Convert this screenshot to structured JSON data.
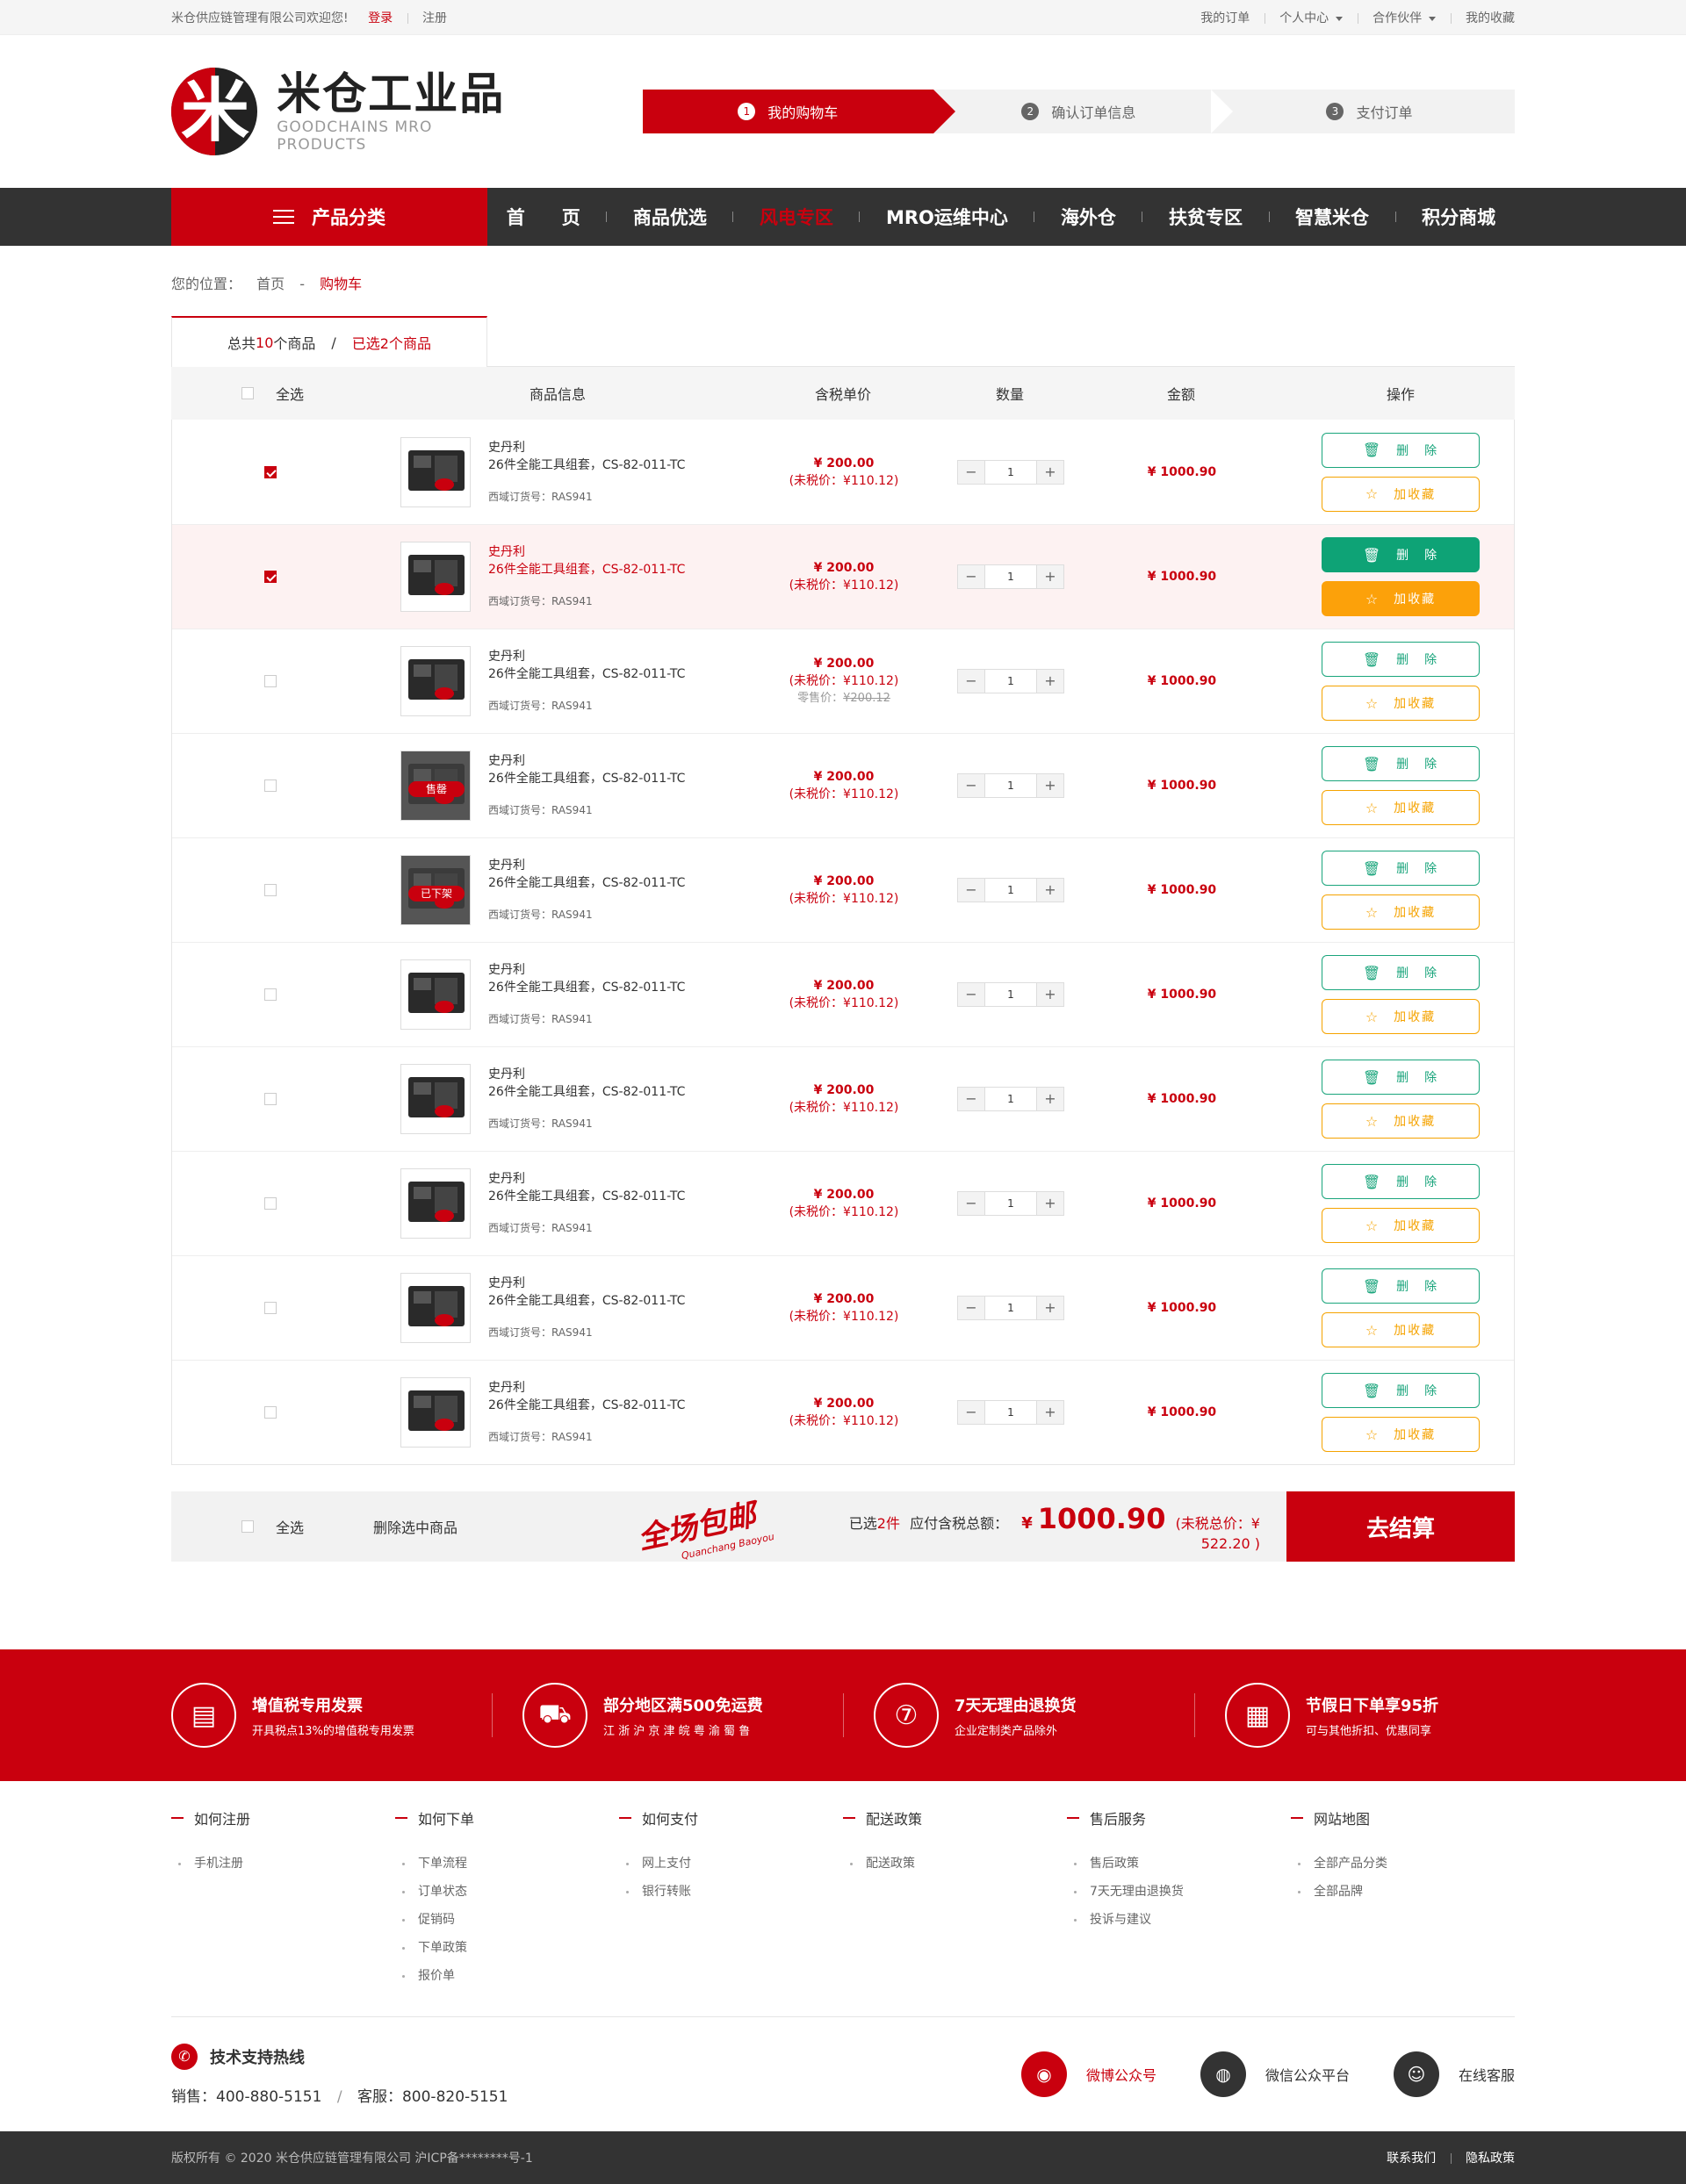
{
  "topbar": {
    "welcome": "米仓供应链管理有限公司欢迎您!",
    "login": "登录",
    "register": "注册",
    "my_orders": "我的订单",
    "personal_center": "个人中心",
    "partners": "合作伙伴",
    "my_favorites": "我的收藏"
  },
  "logo": {
    "cn": "米仓工业品",
    "en": "GOODCHAINS MRO PRODUCTS",
    "glyph": "米"
  },
  "steps": [
    {
      "num": "1",
      "label": "我的购物车"
    },
    {
      "num": "2",
      "label": "确认订单信息"
    },
    {
      "num": "3",
      "label": "支付订单"
    }
  ],
  "nav": {
    "category": "产品分类",
    "links": [
      "首　　页",
      "商品优选",
      "风电专区",
      "MRO运维中心",
      "海外仓",
      "扶贫专区",
      "智慧米仓",
      "积分商城"
    ]
  },
  "breadcrumb": {
    "label": "您的位置：",
    "home": "首页",
    "sep": "-",
    "current": "购物车"
  },
  "cart_tab": {
    "pre": "总共",
    "total": "10",
    "mid": "个商品",
    "slash": "/",
    "selected": "已选2个商品"
  },
  "table_head": {
    "select_all": "全选",
    "info": "商品信息",
    "price": "含税单价",
    "qty": "数量",
    "amount": "金额",
    "ops": "操作"
  },
  "rows": [
    {
      "brand": "史丹利",
      "name": "26件全能工具组套，CS-82-011-TC",
      "sku": "西域订货号：RAS941",
      "price": "¥ 200.00",
      "net": "(未税价：¥110.12)",
      "qty": "1",
      "amount": "¥ 1000.90",
      "checked": true
    },
    {
      "brand": "史丹利",
      "name": "26件全能工具组套，CS-82-011-TC",
      "sku": "西域订货号：RAS941",
      "price": "¥ 200.00",
      "net": "(未税价：¥110.12)",
      "qty": "1",
      "amount": "¥ 1000.90",
      "checked": true
    },
    {
      "brand": "史丹利",
      "name": "26件全能工具组套，CS-82-011-TC",
      "sku": "西域订货号：RAS941",
      "price": "¥ 200.00",
      "net": "(未税价：¥110.12)",
      "retail_label": "零售价：",
      "retail": "¥200.12",
      "qty": "1",
      "amount": "¥ 1000.90",
      "checked": false
    },
    {
      "brand": "史丹利",
      "name": "26件全能工具组套，CS-82-011-TC",
      "sku": "西域订货号：RAS941",
      "price": "¥ 200.00",
      "net": "(未税价：¥110.12)",
      "badge": "售罄",
      "qty": "1",
      "amount": "¥ 1000.90",
      "checked": false
    },
    {
      "brand": "史丹利",
      "name": "26件全能工具组套，CS-82-011-TC",
      "sku": "西域订货号：RAS941",
      "price": "¥ 200.00",
      "net": "(未税价：¥110.12)",
      "badge": "已下架",
      "qty": "1",
      "amount": "¥ 1000.90",
      "checked": false
    },
    {
      "brand": "史丹利",
      "name": "26件全能工具组套，CS-82-011-TC",
      "sku": "西域订货号：RAS941",
      "price": "¥ 200.00",
      "net": "(未税价：¥110.12)",
      "qty": "1",
      "amount": "¥ 1000.90",
      "checked": false
    },
    {
      "brand": "史丹利",
      "name": "26件全能工具组套，CS-82-011-TC",
      "sku": "西域订货号：RAS941",
      "price": "¥ 200.00",
      "net": "(未税价：¥110.12)",
      "qty": "1",
      "amount": "¥ 1000.90",
      "checked": false
    },
    {
      "brand": "史丹利",
      "name": "26件全能工具组套，CS-82-011-TC",
      "sku": "西域订货号：RAS941",
      "price": "¥ 200.00",
      "net": "(未税价：¥110.12)",
      "qty": "1",
      "amount": "¥ 1000.90",
      "checked": false
    },
    {
      "brand": "史丹利",
      "name": "26件全能工具组套，CS-82-011-TC",
      "sku": "西域订货号：RAS941",
      "price": "¥ 200.00",
      "net": "(未税价：¥110.12)",
      "qty": "1",
      "amount": "¥ 1000.90",
      "checked": false
    },
    {
      "brand": "史丹利",
      "name": "26件全能工具组套，CS-82-011-TC",
      "sku": "西域订货号：RAS941",
      "price": "¥ 200.00",
      "net": "(未税价：¥110.12)",
      "qty": "1",
      "amount": "¥ 1000.90",
      "checked": false
    }
  ],
  "row_ops": {
    "delete": "删　除",
    "favorite": "加收藏",
    "minus": "−",
    "plus": "+"
  },
  "summary": {
    "select_all": "全选",
    "delete_selected": "删除选中商品",
    "free_shipping": "全场包邮",
    "free_shipping_sub": "Quanchang Baoyou",
    "selected_pre": "已选",
    "selected_count": "2件",
    "payable_label": "应付含税总额：",
    "currency": "¥",
    "total": "1000.90",
    "net_total": "(未税总价：¥ 522.20 )",
    "checkout": "去结算"
  },
  "features": [
    {
      "icon": "invoice-icon",
      "glyph": "▤",
      "title": "增值税专用发票",
      "sub": "开具税点13%的增值税专用发票"
    },
    {
      "icon": "truck-icon",
      "glyph": "⛟",
      "title": "部分地区满500免运费",
      "sub": "江 浙 沪 京 津 皖 粤 渝 蜀 鲁"
    },
    {
      "icon": "seven-day-icon",
      "glyph": "⑦",
      "title": "7天无理由退换货",
      "sub": "企业定制类产品除外"
    },
    {
      "icon": "calendar-icon",
      "glyph": "▦",
      "title": "节假日下单享95折",
      "sub": "可与其他折扣、优惠同享"
    }
  ],
  "help": [
    {
      "title": "如何注册",
      "items": [
        "手机注册"
      ]
    },
    {
      "title": "如何下单",
      "items": [
        "下单流程",
        "订单状态",
        "促销码",
        "下单政策",
        "报价单"
      ]
    },
    {
      "title": "如何支付",
      "items": [
        "网上支付",
        "银行转账"
      ]
    },
    {
      "title": "配送政策",
      "items": [
        "配送政策"
      ]
    },
    {
      "title": "售后服务",
      "items": [
        "售后政策",
        "7天无理由退换货",
        "投诉与建议"
      ]
    },
    {
      "title": "网站地图",
      "items": [
        "全部产品分类",
        "全部品牌"
      ]
    }
  ],
  "hotline": {
    "title": "技术支持热线",
    "sales_label": "销售：",
    "sales": "400-880-5151",
    "sep": "/",
    "service_label": "客服：",
    "service": "800-820-5151"
  },
  "social": [
    {
      "icon": "weibo-icon",
      "glyph": "◉",
      "label": "微博公众号"
    },
    {
      "icon": "wechat-icon",
      "glyph": "◍",
      "label": "微信公众平台"
    },
    {
      "icon": "customer-service-icon",
      "glyph": "☺",
      "label": "在线客服"
    }
  ],
  "footer": {
    "copyright": "版权所有 © 2020 米仓供应链管理有限公司 沪ICP备********号-1",
    "contact": "联系我们",
    "privacy": "隐私政策"
  },
  "colors": {
    "brand_red": "#c9000e",
    "green": "#0ea376",
    "orange": "#fca10a",
    "dark": "#333333"
  }
}
